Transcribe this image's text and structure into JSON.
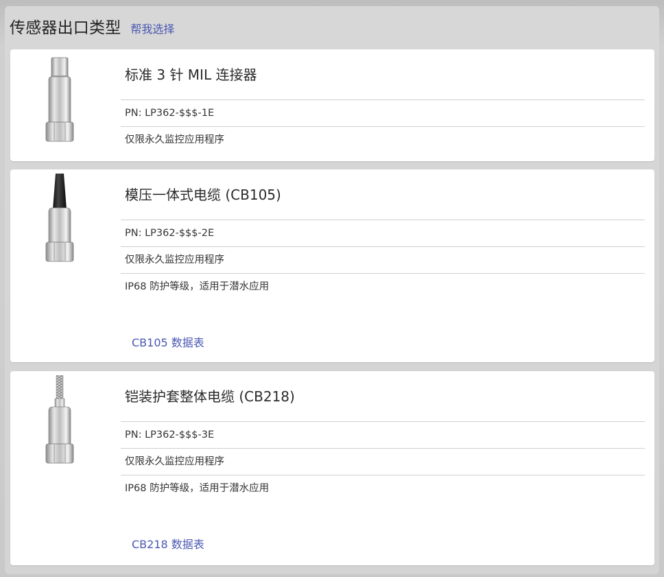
{
  "header": {
    "title": "传感器出口类型",
    "help_link": "帮我选择"
  },
  "options": [
    {
      "title": "标准 3 针 MIL 连接器",
      "pn": "PN: LP362-$$$-1E",
      "features": [
        "仅限永久监控应用程序"
      ],
      "image_icon": "sensor-connector-icon"
    },
    {
      "title": "模压一体式电缆 (CB105)",
      "pn": "PN: LP362-$$$-2E",
      "features": [
        "仅限永久监控应用程序",
        "IP68 防护等级，适用于潜水应用"
      ],
      "datasheet_link": "CB105 数据表",
      "image_icon": "sensor-molded-cable-icon"
    },
    {
      "title": "铠装护套整体电缆 (CB218)",
      "pn": "PN: LP362-$$$-3E",
      "features": [
        "仅限永久监控应用程序",
        "IP68 防护等级，适用于潜水应用"
      ],
      "datasheet_link": "CB218 数据表",
      "image_icon": "sensor-armored-cable-icon"
    }
  ],
  "colors": {
    "link": "#4a57b2",
    "panel": "#d6d6d6",
    "card": "#ffffff",
    "divider": "#cfcfcf"
  }
}
